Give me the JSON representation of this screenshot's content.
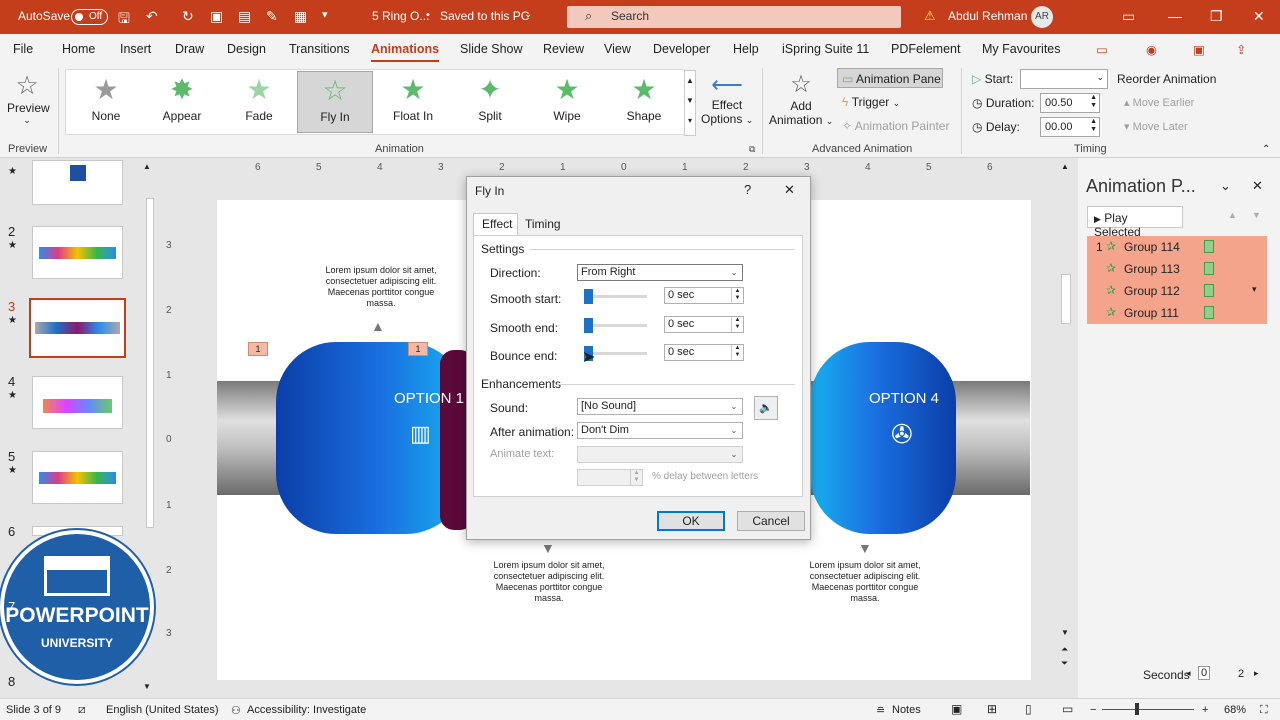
{
  "titlebar": {
    "autosave": "AutoSave",
    "autosave_state": "Off",
    "doc_title": "5 Ring O...",
    "save_state": "Saved to this PC",
    "search_placeholder": "Search",
    "user_name": "Abdul Rehman",
    "user_initials": "AR"
  },
  "menu": [
    "File",
    "Home",
    "Insert",
    "Draw",
    "Design",
    "Transitions",
    "Animations",
    "Slide Show",
    "Review",
    "View",
    "Developer",
    "Help",
    "iSpring Suite 11",
    "PDFelement",
    "My Favourites"
  ],
  "ribbon": {
    "preview_label": "Preview",
    "preview_group": "Preview",
    "animations": [
      "None",
      "Appear",
      "Fade",
      "Fly In",
      "Float In",
      "Split",
      "Wipe",
      "Shape"
    ],
    "selected_animation": "Fly In",
    "effect_options_line1": "Effect",
    "effect_options_line2": "Options",
    "animation_group": "Animation",
    "add_animation_line1": "Add",
    "add_animation_line2": "Animation",
    "animation_pane_btn": "Animation Pane",
    "trigger": "Trigger",
    "animation_painter": "Animation Painter",
    "advanced_group": "Advanced Animation",
    "start_label": "Start:",
    "duration_label": "Duration:",
    "duration_value": "00.50",
    "delay_label": "Delay:",
    "delay_value": "00.00",
    "reorder": "Reorder Animation",
    "move_earlier": "Move Earlier",
    "move_later": "Move Later",
    "timing_group": "Timing"
  },
  "thumbnails": [
    {
      "num": "2"
    },
    {
      "num": "3"
    },
    {
      "num": "4"
    },
    {
      "num": "5"
    },
    {
      "num": "6"
    },
    {
      "num": "7"
    },
    {
      "num": "8"
    }
  ],
  "ruler": {
    "h_ticks": [
      "6",
      "5",
      "4",
      "3",
      "2",
      "1",
      "0",
      "1",
      "2",
      "3",
      "4",
      "5",
      "6"
    ],
    "v_ticks": [
      "3",
      "2",
      "1",
      "0",
      "1",
      "2",
      "3"
    ]
  },
  "slide": {
    "lorem": "Lorem ipsum dolor sit amet, consectetuer adipiscing elit. Maecenas porttitor congue massa.",
    "option1": "OPTION 1",
    "option4": "OPTION 4",
    "tag": "1"
  },
  "dialog": {
    "title": "Fly In",
    "help": "?",
    "close": "✕",
    "tab_effect": "Effect",
    "tab_timing": "Timing",
    "settings": "Settings",
    "direction_label": "Direction:",
    "direction_value": "From Right",
    "smooth_start_label": "Smooth start:",
    "smooth_end_label": "Smooth end:",
    "bounce_end_label": "Bounce end:",
    "sec_value": "0 sec",
    "enhancements": "Enhancements",
    "sound_label": "Sound:",
    "sound_value": "[No Sound]",
    "after_label": "After animation:",
    "after_value": "Don't Dim",
    "animate_text_label": "Animate text:",
    "delay_letters": "% delay between letters",
    "ok": "OK",
    "cancel": "Cancel"
  },
  "pane": {
    "title": "Animation P...",
    "play_selected": "Play Selected",
    "items": [
      {
        "order": "1",
        "name": "Group 114"
      },
      {
        "order": "",
        "name": "Group 113"
      },
      {
        "order": "",
        "name": "Group 112"
      },
      {
        "order": "",
        "name": "Group 111"
      }
    ],
    "seconds": "Seconds",
    "timeline_start": "0",
    "timeline_end": "2"
  },
  "status": {
    "slide_info": "Slide 3 of 9",
    "language": "English (United States)",
    "accessibility": "Accessibility: Investigate",
    "notes": "Notes",
    "zoom": "68%"
  },
  "logo": {
    "line1": "POWERPOINT",
    "line2": "UNIVERSITY"
  },
  "colors": {
    "accent": "#c43e1c",
    "selection": "#f3a48a",
    "blue": "#1e70c8"
  }
}
